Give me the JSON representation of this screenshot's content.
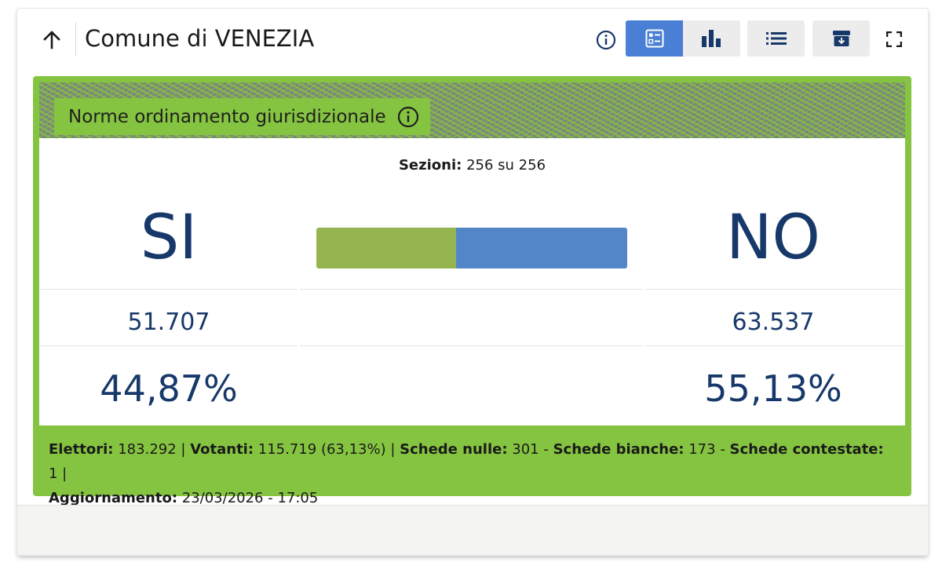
{
  "header": {
    "title": "Comune di VENEZIA",
    "icons": {
      "back": "arrow-up-icon",
      "info": "info-circle-icon",
      "summary_view": "summary-view-icon",
      "chart_view": "bar-chart-icon",
      "list": "list-icon",
      "archive": "archive-download-icon",
      "fullscreen": "fullscreen-icon"
    },
    "active_view": "summary"
  },
  "referendum": {
    "subject": "Norme ordinamento giurisdizionale",
    "sections_label": "Sezioni:",
    "sections_value": "256 su 256",
    "yes": {
      "label": "SI",
      "votes": "51.707",
      "percent": "44,87%",
      "share": 44.87
    },
    "no": {
      "label": "NO",
      "votes": "63.537",
      "percent": "55,13%",
      "share": 55.13
    }
  },
  "footer": {
    "electors_label": "Elettori:",
    "electors_value": "183.292",
    "voters_label": "Votanti:",
    "voters_value": "115.719 (63,13%)",
    "null_label": "Schede nulle:",
    "null_value": "301",
    "blank_label": "Schede bianche:",
    "blank_value": "173",
    "contested_label": "Schede contestate:",
    "contested_value": "1",
    "update_label": "Aggiornamento:",
    "update_value": "23/03/2026 - 17:05"
  },
  "colors": {
    "accent_blue": "#4a7fd6",
    "panel_green": "#85c440",
    "yes_bar": "#95b450",
    "no_bar": "#5386c8",
    "number_navy": "#17386a"
  }
}
